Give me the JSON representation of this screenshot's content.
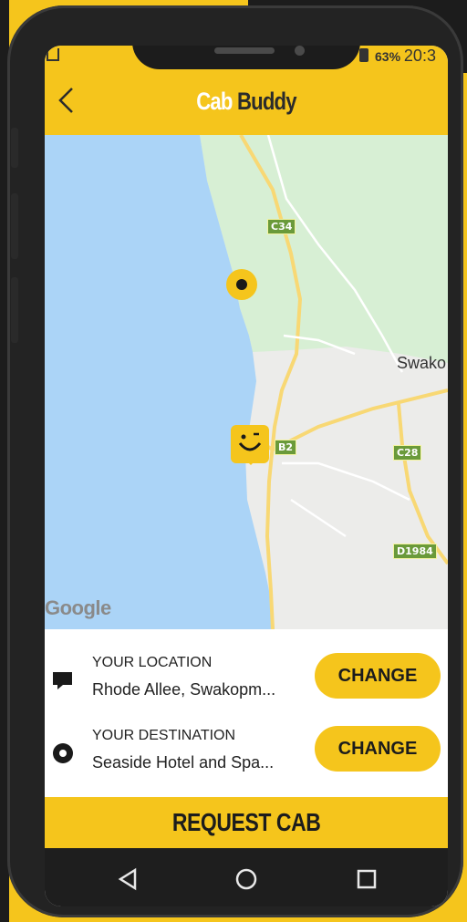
{
  "app": {
    "title_part1": "Cab",
    "title_part2": "Buddy"
  },
  "status_bar": {
    "battery": "63%",
    "time": "20:3"
  },
  "map": {
    "place_label": "Swako",
    "road_shields": [
      "C34",
      "B2",
      "C28",
      "D1984"
    ],
    "attribution": "Google",
    "colors": {
      "water": "#abd4f7",
      "park": "#d7efd4",
      "land": "#ececea",
      "road": "#f8d874"
    }
  },
  "location": {
    "label": "YOUR LOCATION",
    "value": "Rhode Allee, Swakopm...",
    "button": "CHANGE"
  },
  "destination": {
    "label": "YOUR DESTINATION",
    "value": "Seaside Hotel and Spa...",
    "button": "CHANGE"
  },
  "request_button": "REQUEST CAB",
  "nav": {
    "back": "back-icon",
    "home": "home-icon",
    "recents": "recents-icon"
  },
  "theme": {
    "accent": "#f5c51c",
    "dark": "#1c1c1c"
  }
}
